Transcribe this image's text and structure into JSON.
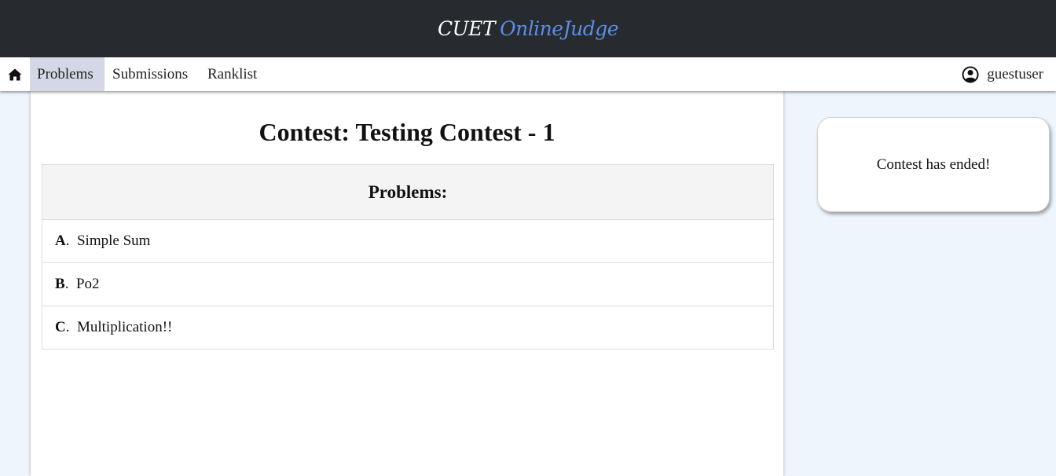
{
  "brand": {
    "part1": "CUET",
    "part2": "OnlineJudge"
  },
  "nav": {
    "home_icon": "home-icon",
    "items": [
      {
        "label": "Problems",
        "active": true
      },
      {
        "label": "Submissions",
        "active": false
      },
      {
        "label": "Ranklist",
        "active": false
      }
    ],
    "user": {
      "icon": "user-circle-icon",
      "name": "guestuser"
    }
  },
  "contest": {
    "title": "Contest: Testing Contest - 1",
    "problems_header": "Problems:",
    "problems": [
      {
        "id": "A",
        "sep": ".",
        "name": "Simple Sum"
      },
      {
        "id": "B",
        "sep": ".",
        "name": "Po2"
      },
      {
        "id": "C",
        "sep": ".",
        "name": "Multiplication!!"
      }
    ]
  },
  "sidebar": {
    "status": "Contest has ended!"
  },
  "colors": {
    "topbar": "#272b2f",
    "brand_accent": "#5a8ee6",
    "active_nav": "#d3d7e6",
    "page_bg": "#eef5fd"
  }
}
